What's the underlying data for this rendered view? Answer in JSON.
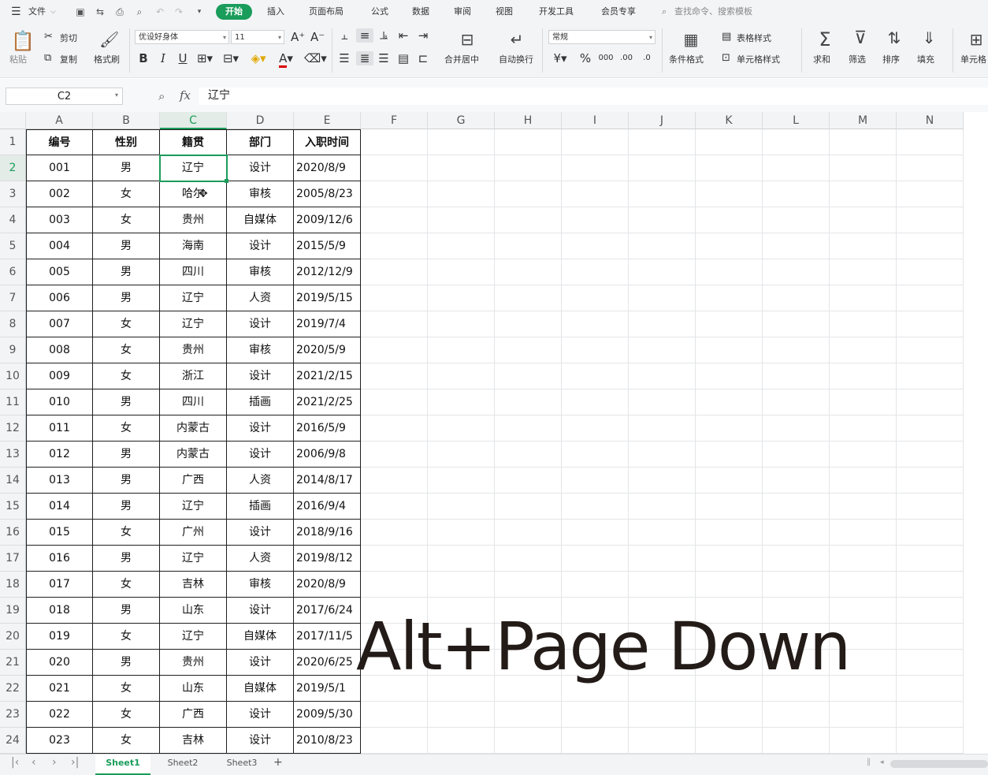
{
  "menu": {
    "file": "文件",
    "tabs": [
      "开始",
      "插入",
      "页面布局",
      "公式",
      "数据",
      "审阅",
      "视图",
      "开发工具",
      "会员专享"
    ],
    "active_tab": "开始",
    "search_placeholder": "查找命令、搜索模板"
  },
  "ribbon": {
    "paste": "粘贴",
    "cut": "剪切",
    "copy": "复制",
    "format_painter": "格式刷",
    "font_name": "优设好身体",
    "font_size": "11",
    "number_format": "常规",
    "merge_center": "合并居中",
    "wrap_text": "自动换行",
    "conditional_format": "条件格式",
    "table_style": "表格样式",
    "cell_style": "单元格样式",
    "sum": "求和",
    "filter": "筛选",
    "sort": "排序",
    "fill": "填充",
    "cell": "单元格"
  },
  "formula_bar": {
    "name_box": "C2",
    "fx": "fx",
    "content": "辽宁"
  },
  "columns": [
    "A",
    "B",
    "C",
    "D",
    "E",
    "F",
    "G",
    "H",
    "I",
    "J",
    "K",
    "L",
    "M",
    "N"
  ],
  "active_column": "C",
  "active_row": 2,
  "headers": [
    "编号",
    "性别",
    "籍贯",
    "部门",
    "入职时间"
  ],
  "rows": [
    [
      "001",
      "男",
      "辽宁",
      "设计",
      "2020/8/9"
    ],
    [
      "002",
      "女",
      "哈尔",
      "审核",
      "2005/8/23"
    ],
    [
      "003",
      "女",
      "贵州",
      "自媒体",
      "2009/12/6"
    ],
    [
      "004",
      "男",
      "海南",
      "设计",
      "2015/5/9"
    ],
    [
      "005",
      "男",
      "四川",
      "审核",
      "2012/12/9"
    ],
    [
      "006",
      "男",
      "辽宁",
      "人资",
      "2019/5/15"
    ],
    [
      "007",
      "女",
      "辽宁",
      "设计",
      "2019/7/4"
    ],
    [
      "008",
      "女",
      "贵州",
      "审核",
      "2020/5/9"
    ],
    [
      "009",
      "女",
      "浙江",
      "设计",
      "2021/2/15"
    ],
    [
      "010",
      "男",
      "四川",
      "插画",
      "2021/2/25"
    ],
    [
      "011",
      "女",
      "内蒙古",
      "设计",
      "2016/5/9"
    ],
    [
      "012",
      "男",
      "内蒙古",
      "设计",
      "2006/9/8"
    ],
    [
      "013",
      "男",
      "广西",
      "人资",
      "2014/8/17"
    ],
    [
      "014",
      "男",
      "辽宁",
      "插画",
      "2016/9/4"
    ],
    [
      "015",
      "女",
      "广州",
      "设计",
      "2018/9/16"
    ],
    [
      "016",
      "男",
      "辽宁",
      "人资",
      "2019/8/12"
    ],
    [
      "017",
      "女",
      "吉林",
      "审核",
      "2020/8/9"
    ],
    [
      "018",
      "男",
      "山东",
      "设计",
      "2017/6/24"
    ],
    [
      "019",
      "女",
      "辽宁",
      "自媒体",
      "2017/11/5"
    ],
    [
      "020",
      "男",
      "贵州",
      "设计",
      "2020/6/25"
    ],
    [
      "021",
      "女",
      "山东",
      "自媒体",
      "2019/5/1"
    ],
    [
      "022",
      "女",
      "广西",
      "设计",
      "2009/5/30"
    ],
    [
      "023",
      "女",
      "吉林",
      "设计",
      "2010/8/23"
    ]
  ],
  "overlay_text": "Alt+Page Down",
  "sheets": [
    "Sheet1",
    "Sheet2",
    "Sheet3"
  ],
  "active_sheet": "Sheet1",
  "accent_color": "#1a9c5a"
}
